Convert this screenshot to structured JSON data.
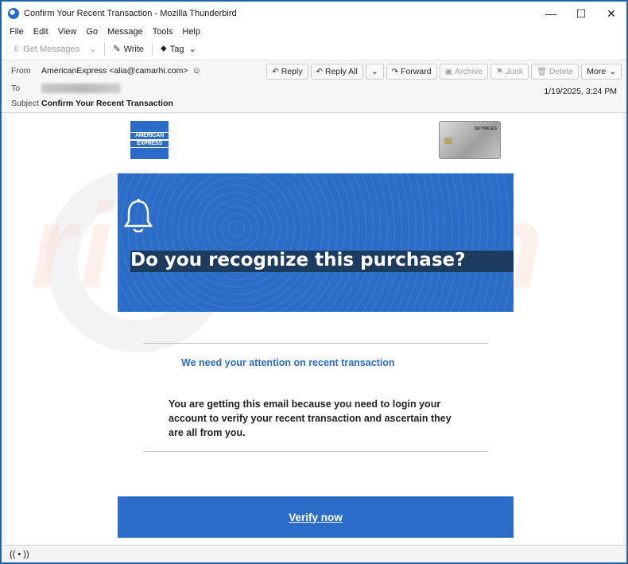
{
  "window": {
    "title": "Confirm Your Recent Transaction - Mozilla Thunderbird",
    "minimize": "—",
    "maximize": "☐",
    "close": "✕"
  },
  "menu": [
    {
      "label": "File"
    },
    {
      "label": "Edit"
    },
    {
      "label": "View"
    },
    {
      "label": "Go"
    },
    {
      "label": "Message"
    },
    {
      "label": "Tools"
    },
    {
      "label": "Help"
    }
  ],
  "toolbar": {
    "get_messages": "Get Messages",
    "write": "Write",
    "tag": "Tag"
  },
  "header": {
    "from_label": "From",
    "from_value": "AmericanExpress <alia@camarhi.com>",
    "to_label": "To",
    "subject_label": "Subject",
    "subject_value": "Confirm Your Recent Transaction",
    "date": "1/19/2025, 3:24 PM",
    "actions": {
      "reply": "Reply",
      "reply_all": "Reply All",
      "forward": "Forward",
      "archive": "Archive",
      "junk": "Junk",
      "delete": "Delete",
      "more": "More"
    }
  },
  "email": {
    "logo_line1": "AMERICAN",
    "logo_line2": "EXPRESS",
    "card_brand": "SKYMILES",
    "banner_title": "Do you recognize this purchase?",
    "subhead": "We need your attention on recent transaction",
    "body": "You are getting this email because you need to login your account to verify your recent transaction and ascertain they are all from you.",
    "cta": "Verify now"
  },
  "status": {
    "icon": "(( • ))"
  },
  "colors": {
    "amex_blue": "#2a6cc7",
    "banner_strip": "#1c3b5e"
  }
}
